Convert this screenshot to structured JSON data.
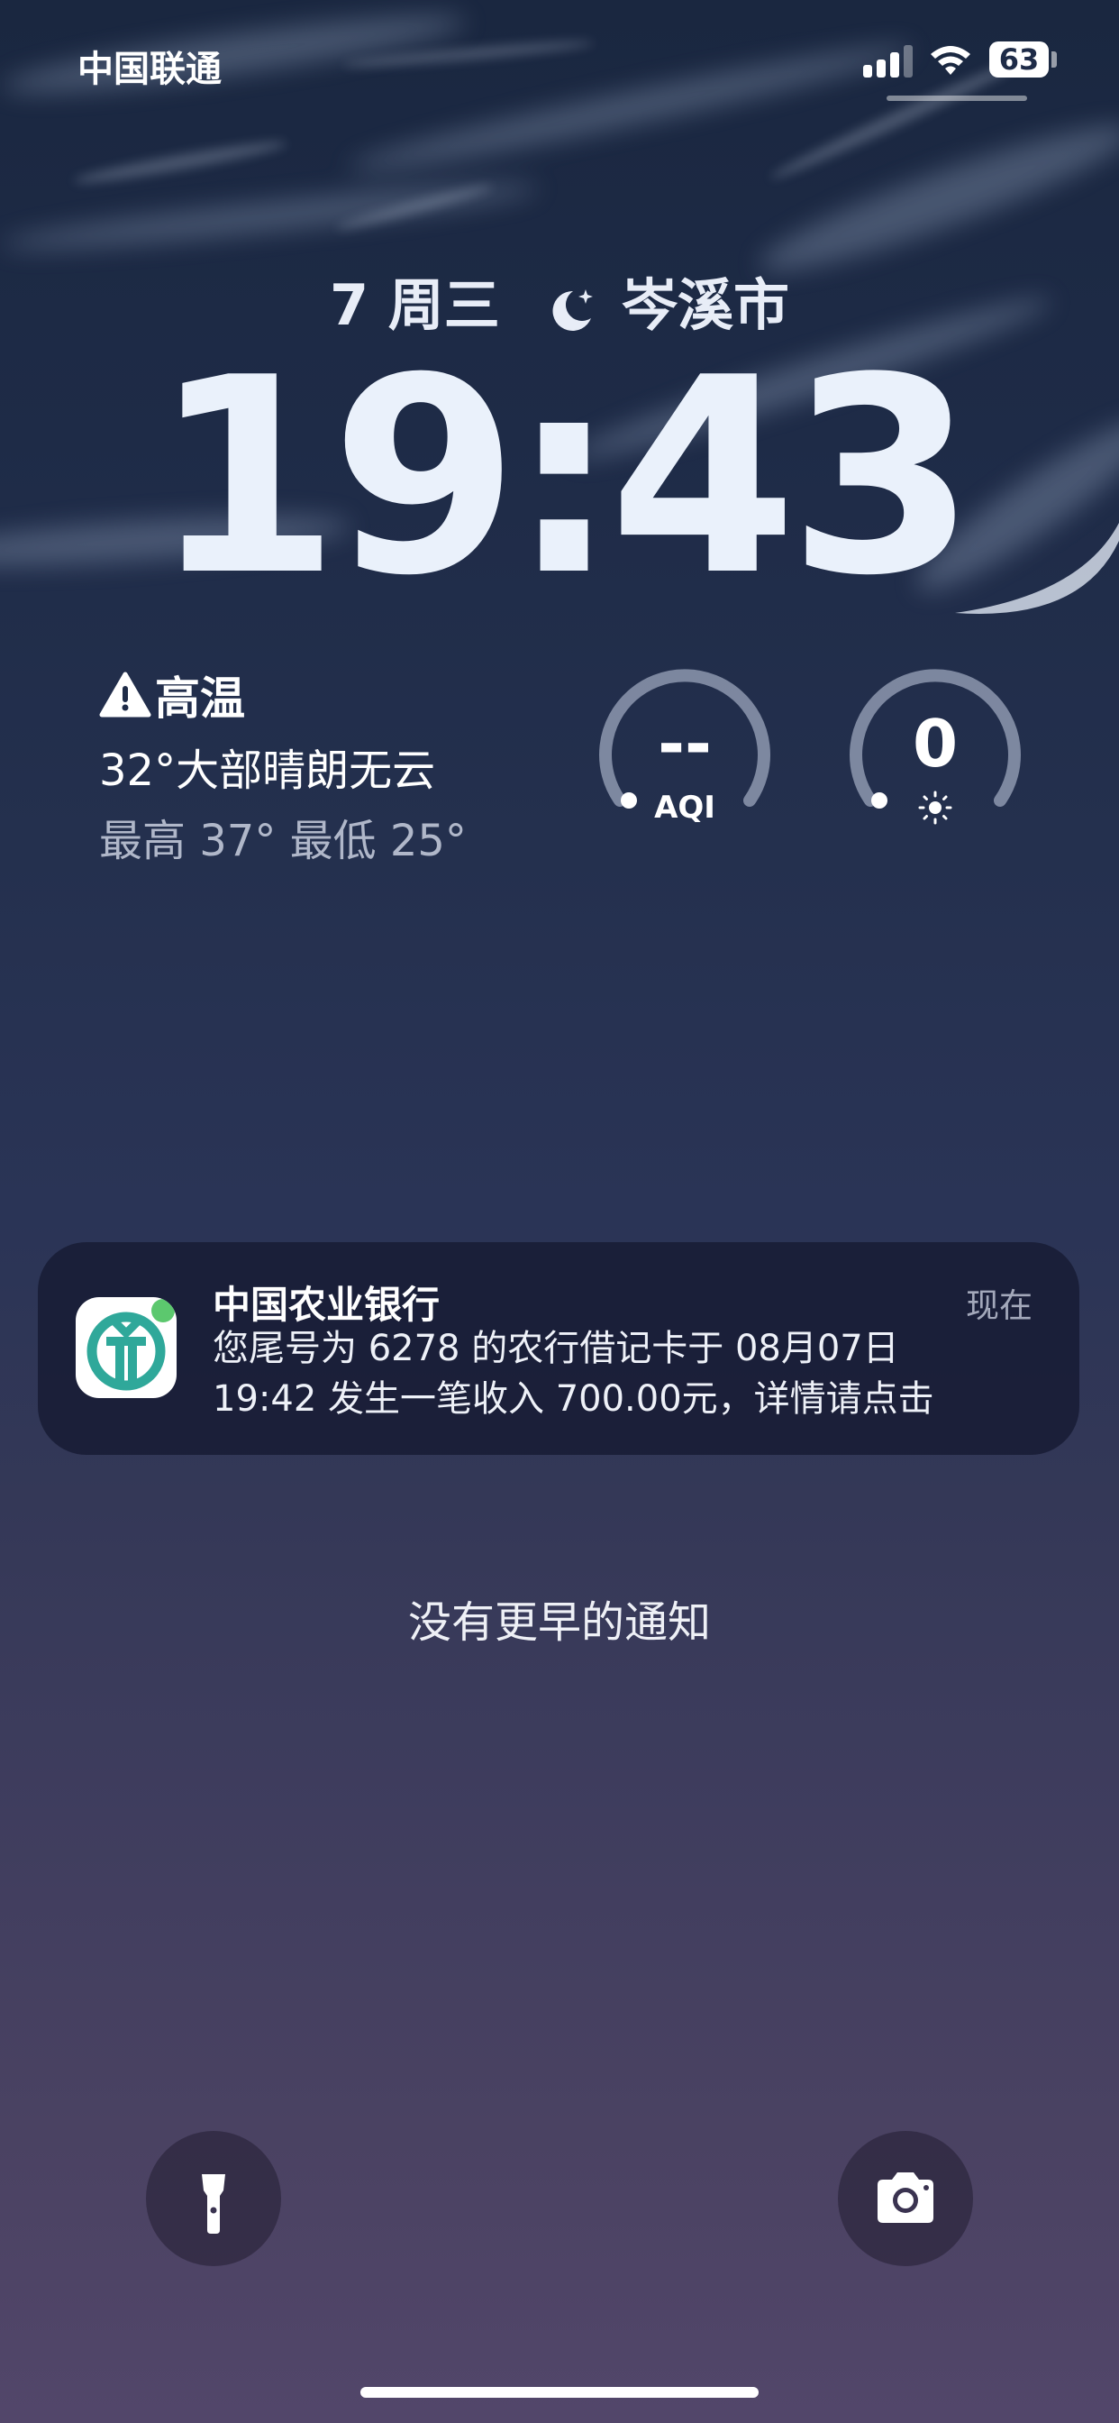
{
  "status_bar": {
    "carrier": "中国联通",
    "battery_level": "63",
    "icons": [
      "cellular-signal-icon",
      "wifi-icon",
      "battery-icon"
    ]
  },
  "lock_screen": {
    "date": "7 周三",
    "location": "岑溪市",
    "time": "19:43"
  },
  "weather": {
    "alert_label": "高温",
    "condition": "32°大部晴朗无云",
    "range": "最高 37° 最低 25°",
    "icons": [
      "warning-icon",
      "moon-icon"
    ]
  },
  "widgets": {
    "aqi": {
      "value": "--",
      "label": "AQI"
    },
    "uv": {
      "value": "0",
      "icon": "sun-icon"
    }
  },
  "notification": {
    "app": "中国农业银行",
    "time": "现在",
    "line1": "您尾号为 6278 的农行借记卡于 08月07日",
    "line2": "19:42 发生一笔收入 700.00元，详情请点击",
    "app_icon": "abc-bank-icon",
    "icon_color": "#2fa89a"
  },
  "no_older": "没有更早的通知",
  "quick_actions": {
    "left_icon": "flashlight-icon",
    "right_icon": "camera-icon"
  }
}
